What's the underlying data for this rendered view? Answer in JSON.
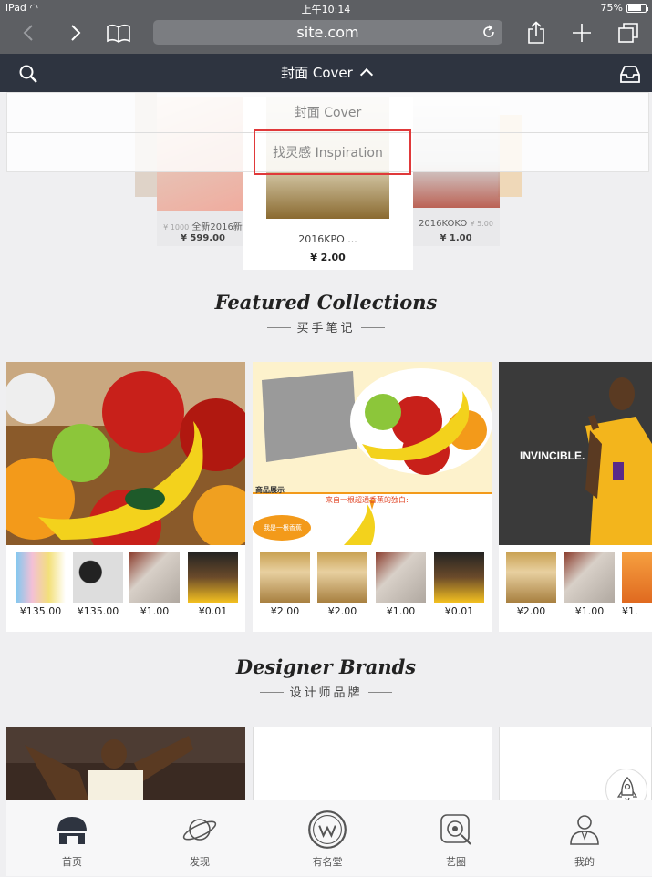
{
  "status": {
    "device": "iPad",
    "time": "上午10:14",
    "battery": "75%",
    "battery_level": 0.75
  },
  "safari": {
    "url": "site.com"
  },
  "nav": {
    "title": "封面 Cover"
  },
  "dropdown": {
    "items": [
      "封面 Cover",
      "找灵感 Inspiration"
    ]
  },
  "strip": {
    "left": {
      "name": "全新2016新",
      "old_price": "¥ 1000",
      "price": "¥ 599.00"
    },
    "center": {
      "name": "2016KPO ...",
      "price": "¥ 2.00"
    },
    "right": {
      "name": "2016KOKO",
      "old_price": "¥ 5.00",
      "price": "¥ 1.00"
    }
  },
  "sections": {
    "featured": {
      "title": "Featured Collections",
      "subtitle": "买手笔记"
    },
    "designer": {
      "title": "Designer Brands",
      "subtitle": "设计师品牌"
    }
  },
  "collections": [
    {
      "hero": "banana-apple",
      "thumbs": [
        "¥135.00",
        "¥135.00",
        "¥1.00",
        "¥0.01"
      ]
    },
    {
      "hero": "promo-fruit",
      "hero_text": "商品展示",
      "hero_text2": "来自一根超通香蕉的独白:",
      "hero_bubble": "我是一根香蕉",
      "thumbs": [
        "¥2.00",
        "¥2.00",
        "¥1.00",
        "¥0.01"
      ]
    },
    {
      "hero": "basketball-player",
      "hero_text": "INVINCIBLE.",
      "thumbs": [
        "¥2.00",
        "¥1.00",
        "¥1."
      ]
    }
  ],
  "tabs": [
    "首页",
    "发现",
    "有名堂",
    "艺圈",
    "我的"
  ]
}
